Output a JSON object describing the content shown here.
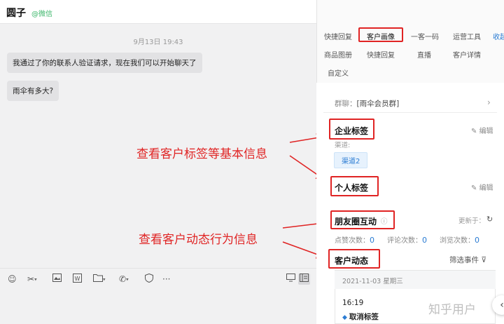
{
  "header": {
    "name": "圆子",
    "source": "@微信"
  },
  "chat": {
    "timestamp": "9月13日 19:43",
    "messages": [
      "我通过了你的联系人验证请求，现在我们可以开始聊天了",
      "雨伞有多大?"
    ]
  },
  "annotations": {
    "top": "查看客户标签等基本信息",
    "bottom": "查看客户动态行为信息"
  },
  "toolbar": {
    "icons": [
      "smile-icon",
      "scissors-icon",
      "image-icon",
      "word-icon",
      "folder-icon",
      "phone-icon",
      "shield-icon",
      "more-icon",
      "screen-icon",
      "sidebar-icon"
    ],
    "more": "···"
  },
  "tabs": {
    "row1": [
      "快捷回复",
      "客户画像",
      "一客一码",
      "运营工具",
      "收起"
    ],
    "row2": [
      "商品图册",
      "快捷回复",
      "直播",
      "客户详情"
    ],
    "row3": [
      "自定义"
    ]
  },
  "profile": {
    "group_label": "群聊：",
    "group_value": "[雨伞会员群]",
    "enterprise_tags": "企业标签",
    "edit": "编辑",
    "channel_label": "渠道:",
    "channel_chip": "渠道2",
    "personal_tags": "个人标签",
    "moments": "朋友圈互动",
    "update": "更新于：",
    "stats": [
      {
        "label": "点赞次数：",
        "value": "0"
      },
      {
        "label": "评论次数：",
        "value": "0"
      },
      {
        "label": "浏览次数：",
        "value": "0"
      }
    ],
    "dynamics": "客户动态",
    "filter": "筛选事件",
    "event_date": "2021-11-03 星期三",
    "event_time": "16:19",
    "event_action": "取消标签"
  },
  "watermark": "知乎用户",
  "colors": {
    "annotation_red": "#e02424",
    "accent_blue": "#2b7cd3",
    "brand_green": "#3bb66a"
  }
}
